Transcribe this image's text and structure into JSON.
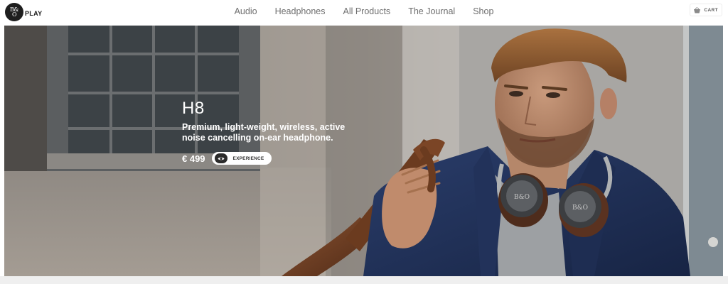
{
  "brand": {
    "mark_line1": "B&",
    "mark_line2": "O",
    "name": "PLAY"
  },
  "nav": {
    "items": [
      {
        "label": "Audio"
      },
      {
        "label": "Headphones"
      },
      {
        "label": "All Products"
      },
      {
        "label": "The Journal"
      },
      {
        "label": "Shop"
      }
    ]
  },
  "cart": {
    "icon": "basket-icon",
    "label": "CART"
  },
  "hero": {
    "product_name": "H8",
    "tagline": "Premium, light-weight, wireless, active noise cancelling on-ear headphone.",
    "price": "€ 499",
    "cta_icon": "eye-icon",
    "cta_label": "EXPERIENCE",
    "image": "photo of a man in a navy blazer wearing brown-and-black headphones around his neck, holding a leather bag strap over his shoulder"
  },
  "colors": {
    "header_bg": "#ffffff",
    "nav_text": "#6e6e6e",
    "hero_text": "#ffffff",
    "blazer": "#1f2f55",
    "bottom_strip": "#efefef"
  }
}
